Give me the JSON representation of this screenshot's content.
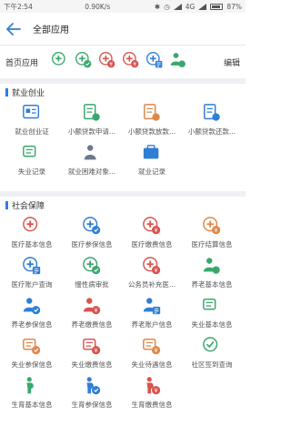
{
  "status": {
    "time": "下午2:54",
    "speed": "0.90K/s",
    "network": "4G",
    "battery": "87%"
  },
  "header": {
    "title": "全部应用"
  },
  "shortcut": {
    "label": "首页应用",
    "edit": "编辑",
    "icons": [
      {
        "icon": "medical-plus-icon",
        "color": "#3aa76d"
      },
      {
        "icon": "medical-shield-icon",
        "color": "#3aa76d"
      },
      {
        "icon": "medical-coin-icon",
        "color": "#d9534f"
      },
      {
        "icon": "medical-coin-icon",
        "color": "#d9534f"
      },
      {
        "icon": "medical-list-icon",
        "color": "#2f7fd4"
      },
      {
        "icon": "person-pension-icon",
        "color": "#3aa76d"
      }
    ]
  },
  "sections": [
    {
      "title": "就业创业",
      "items": [
        {
          "label": "就业创业证",
          "icon": "id-card-icon",
          "color": "#2f7fd4"
        },
        {
          "label": "小额贷款申请...",
          "icon": "loan-doc-icon",
          "color": "#3aa76d"
        },
        {
          "label": "小额贷款放款...",
          "icon": "loan-doc-icon",
          "color": "#e0874a"
        },
        {
          "label": "小额贷款还款...",
          "icon": "loan-doc-icon",
          "color": "#2f7fd4"
        },
        {
          "label": "失业记录",
          "icon": "unemploy-icon",
          "color": "#3aa76d"
        },
        {
          "label": "就业困难对象...",
          "icon": "hardship-icon",
          "color": "#6b7a8a"
        },
        {
          "label": "就业记录",
          "icon": "briefcase-icon",
          "color": "#2f7fd4"
        }
      ]
    },
    {
      "title": "社会保障",
      "items": [
        {
          "label": "医疗基本信息",
          "icon": "medical-plus-icon",
          "color": "#d9534f"
        },
        {
          "label": "医疗参保信息",
          "icon": "medical-shield-icon",
          "color": "#2f7fd4"
        },
        {
          "label": "医疗缴费信息",
          "icon": "medical-coin-icon",
          "color": "#d9534f"
        },
        {
          "label": "医疗结算信息",
          "icon": "medical-coin-icon",
          "color": "#e0874a"
        },
        {
          "label": "医疗账户查询",
          "icon": "medical-list-icon",
          "color": "#2f7fd4"
        },
        {
          "label": "慢性病审批",
          "icon": "medical-shield-icon",
          "color": "#3aa76d"
        },
        {
          "label": "公务员补充医...",
          "icon": "medical-coin-icon",
          "color": "#d9534f"
        },
        {
          "label": "养老基本信息",
          "icon": "person-pension-icon",
          "color": "#3aa76d"
        },
        {
          "label": "养老参保信息",
          "icon": "person-shield-icon",
          "color": "#2f7fd4"
        },
        {
          "label": "养老缴费信息",
          "icon": "person-coin-icon",
          "color": "#d9534f"
        },
        {
          "label": "养老账户信息",
          "icon": "person-list-icon",
          "color": "#2f7fd4"
        },
        {
          "label": "失业基本信息",
          "icon": "unemploy-icon",
          "color": "#3aa76d"
        },
        {
          "label": "失业参保信息",
          "icon": "unemploy-shield-icon",
          "color": "#e0874a"
        },
        {
          "label": "失业缴费信息",
          "icon": "unemploy-coin-icon",
          "color": "#d9534f"
        },
        {
          "label": "失业待遇信息",
          "icon": "unemploy-coin-icon",
          "color": "#e0874a"
        },
        {
          "label": "社区签到查询",
          "icon": "sign-in-icon",
          "color": "#3aa76d"
        },
        {
          "label": "生育基本信息",
          "icon": "pregnant-icon",
          "color": "#3aa76d"
        },
        {
          "label": "生育参保信息",
          "icon": "pregnant-shield-icon",
          "color": "#2f7fd4"
        },
        {
          "label": "生育缴费信息",
          "icon": "pregnant-coin-icon",
          "color": "#d9534f"
        }
      ]
    }
  ]
}
